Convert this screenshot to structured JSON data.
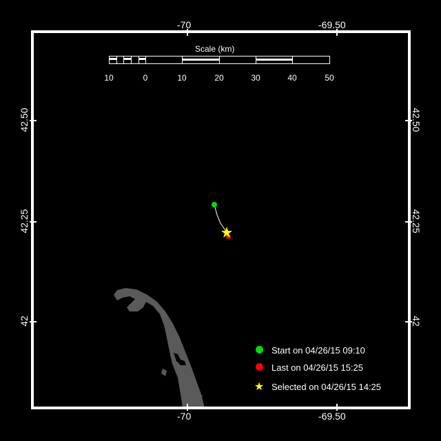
{
  "map": {
    "scale": {
      "title": "Scale (km)",
      "ticks": [
        "10",
        "0",
        "10",
        "20",
        "30",
        "40",
        "50"
      ]
    },
    "axes": {
      "top": [
        "-70",
        "-69.50"
      ],
      "bottom": [
        "-70",
        "-69.50"
      ],
      "left": [
        "42.50",
        "42.25",
        "42"
      ],
      "right": [
        "42.50",
        "42.25",
        "42"
      ]
    },
    "legend": [
      {
        "label": "Start on 04/26/15 09:10",
        "color": "#00e000",
        "marker": "dot"
      },
      {
        "label": "Last on 04/26/15 15:25",
        "color": "#ff0000",
        "marker": "dot"
      },
      {
        "label": "Selected on 04/26/15 14:25",
        "color": "#ffff00",
        "marker": "star"
      }
    ],
    "colors": {
      "background": "#000000",
      "frame": "#ffffff",
      "land": "#5a5a5a",
      "track": "#ffffff"
    }
  }
}
